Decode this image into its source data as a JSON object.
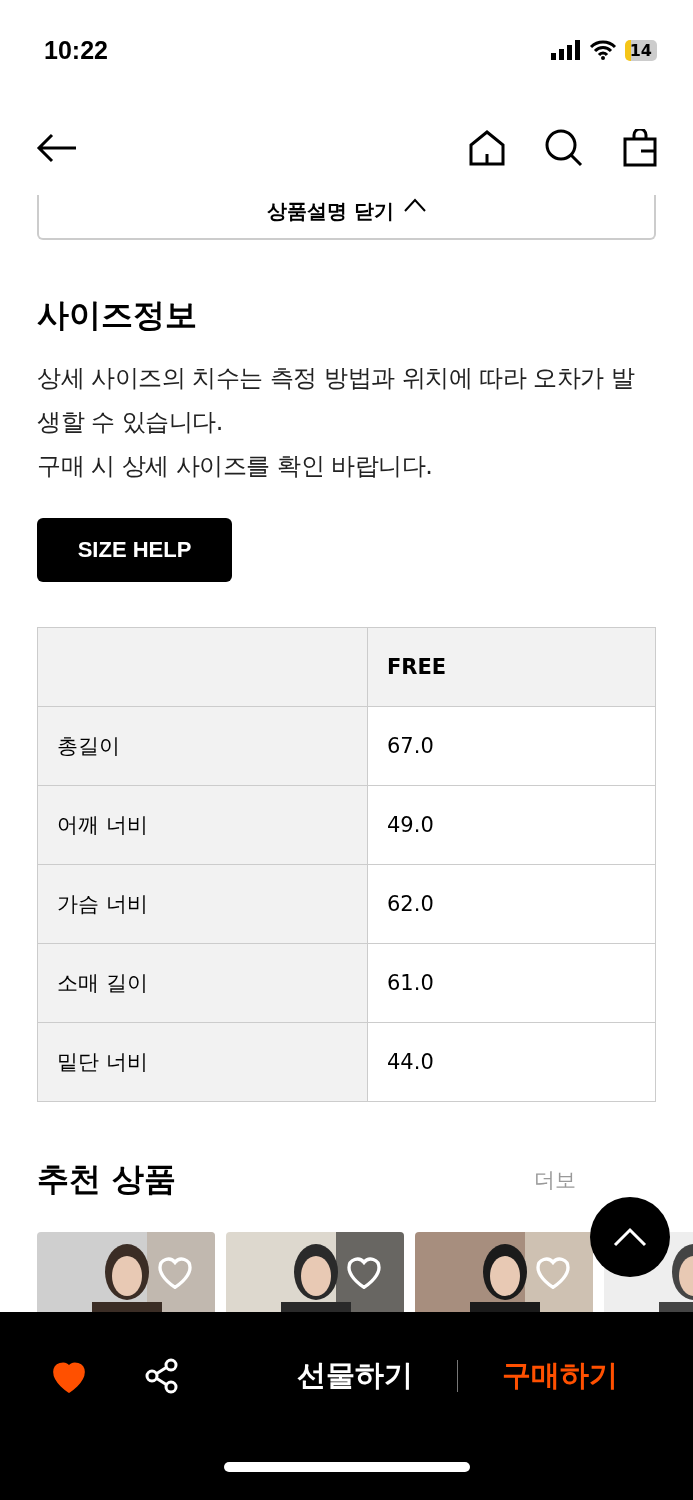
{
  "status_bar": {
    "time": "10:22",
    "battery": "14"
  },
  "collapse_button": {
    "label": "상품설명 닫기"
  },
  "size_info": {
    "title": "사이즈정보",
    "notice": [
      "상세 사이즈의 치수는 측정 방법과 위치에 따라 오차가 발생할 수 있습니다.",
      "구매 시 상세 사이즈를 확인 바랍니다."
    ],
    "help_button": "SIZE HELP",
    "table": {
      "columns": [
        "FREE"
      ],
      "rows": [
        {
          "label": "총길이",
          "values": [
            "67.0"
          ]
        },
        {
          "label": "어깨 너비",
          "values": [
            "49.0"
          ]
        },
        {
          "label": "가슴 너비",
          "values": [
            "62.0"
          ]
        },
        {
          "label": "소매 길이",
          "values": [
            "61.0"
          ]
        },
        {
          "label": "밑단 너비",
          "values": [
            "44.0"
          ]
        }
      ]
    }
  },
  "recommended": {
    "title": "추천 상품",
    "more": "더보"
  },
  "bottom_bar": {
    "liked": true,
    "gift": "선물하기",
    "buy": "구매하기"
  }
}
